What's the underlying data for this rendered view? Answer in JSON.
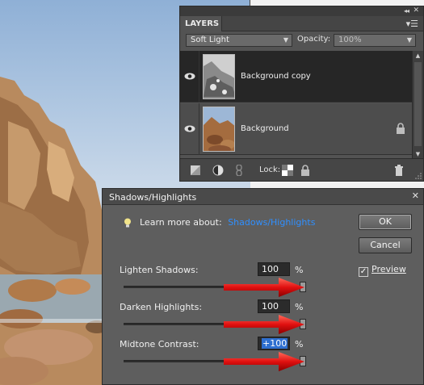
{
  "layers_panel": {
    "tab_label": "LAYERS",
    "blend_mode": "Soft Light",
    "opacity_label": "Opacity:",
    "opacity_value": "100%",
    "lock_label": "Lock:",
    "layers": [
      {
        "name": "Background copy",
        "selected": true,
        "locked": false
      },
      {
        "name": "Background",
        "selected": false,
        "locked": true
      }
    ]
  },
  "dialog": {
    "title": "Shadows/Highlights",
    "learn_more_label": "Learn more about:",
    "learn_more_link": "Shadows/Highlights",
    "ok_label": "OK",
    "cancel_label": "Cancel",
    "preview_label": "Preview",
    "preview_checked": true,
    "sliders": [
      {
        "label": "Lighten Shadows:",
        "value": "100",
        "unit": "%"
      },
      {
        "label": "Darken Highlights:",
        "value": "100",
        "unit": "%"
      },
      {
        "label": "Midtone Contrast:",
        "value": "+100",
        "unit": "%"
      }
    ]
  },
  "colors": {
    "panel_bg": "#535353",
    "dialog_bg": "#5e5e5e",
    "link": "#2f8fff",
    "annotation_arrow": "#e01010"
  },
  "icons": [
    "eye-icon",
    "lock-icon",
    "lightbulb-icon",
    "trash-icon",
    "panel-menu-icon",
    "collapse-icon",
    "close-icon"
  ]
}
